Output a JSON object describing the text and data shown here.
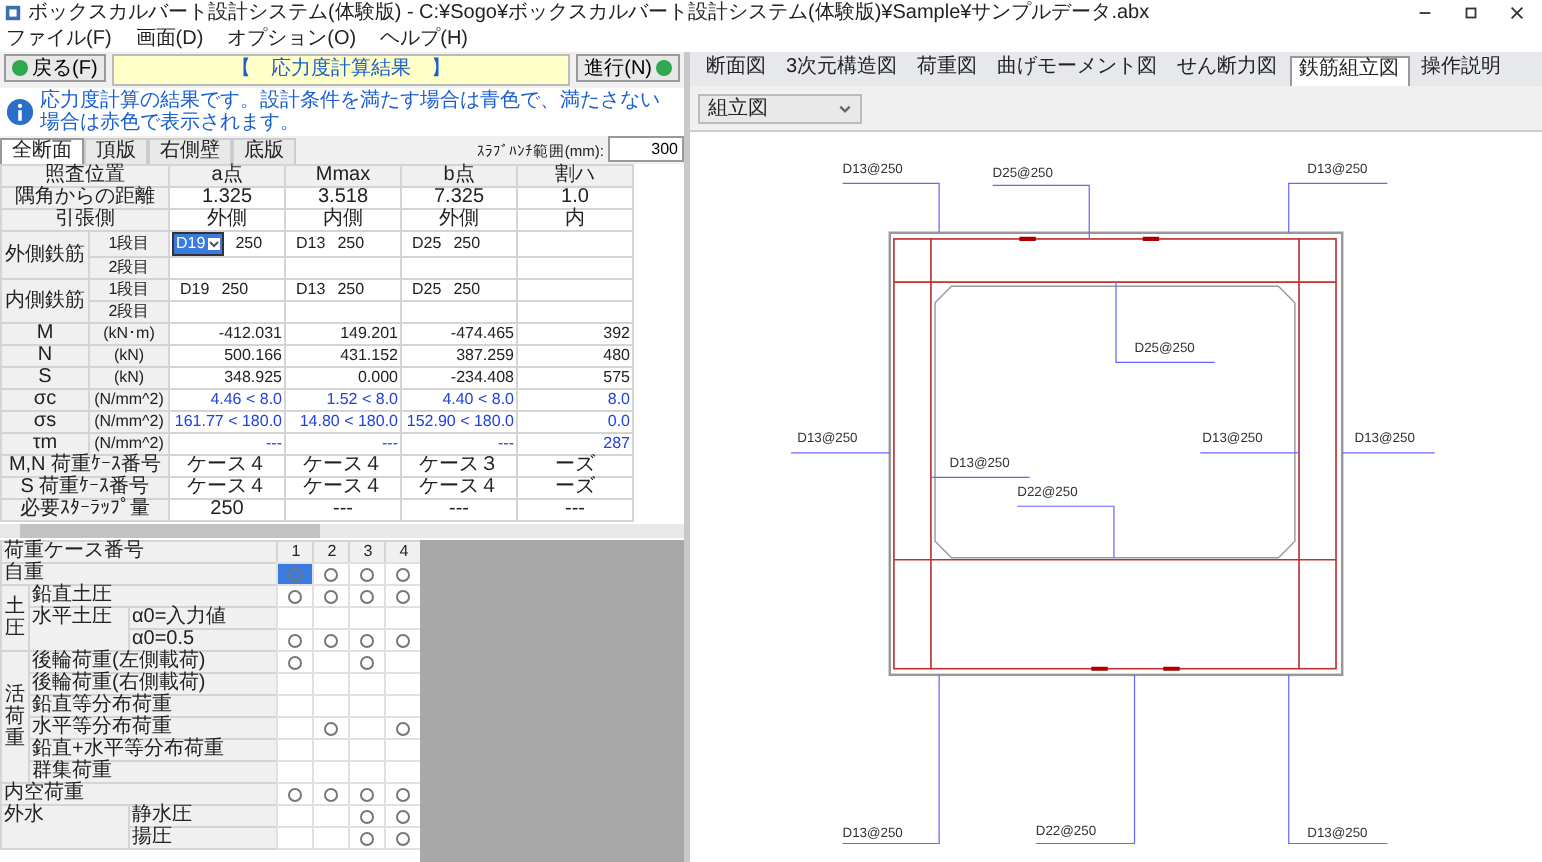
{
  "window": {
    "title": "ボックスカルバート設計システム(体験版) - C:¥Sogo¥ボックスカルバート設計システム(体験版)¥Sample¥サンプルデータ.abx"
  },
  "menu": [
    "ファイル(F)",
    "画面(D)",
    "オプション(O)",
    "ヘルプ(H)"
  ],
  "left_panel": {
    "back_button": "戻る(F)",
    "heading": "【　応力度計算結果　】",
    "next_button": "進行(N)",
    "info": "応力度計算の結果です。設計条件を満たす場合は青色で、満たさない場合は赤色で表示されます。",
    "tabs": [
      {
        "label": "全断面",
        "selected": true
      },
      {
        "label": "頂版",
        "selected": false
      },
      {
        "label": "右側壁",
        "selected": false
      },
      {
        "label": "底版",
        "selected": false
      }
    ],
    "haunch_range": {
      "label": "ｽﾗﾌﾞﾊﾝﾁ範囲(mm):",
      "value": "300"
    },
    "result_table": {
      "columns": [
        "照査位置",
        "a点",
        "Mmax",
        "b点",
        "割ハ"
      ],
      "rows": [
        {
          "kind": "span",
          "label": "隅角からの距離",
          "cells": [
            "1.325",
            "3.518",
            "7.325",
            "1.0"
          ]
        },
        {
          "kind": "span",
          "label": "引張側",
          "cells": [
            "外側",
            "内側",
            "外側",
            "内"
          ]
        },
        {
          "kind": "rebar",
          "label": "外側鉄筋",
          "tiers": [
            {
              "label": "1段目",
              "cells": [
                {
                  "bar": "D19",
                  "pitch": "250",
                  "selected": true
                },
                {
                  "bar": "D13",
                  "pitch": "250",
                  "selected": false
                },
                {
                  "bar": "D25",
                  "pitch": "250",
                  "selected": false
                }
              ]
            },
            {
              "label": "2段目"
            }
          ]
        },
        {
          "kind": "rebar",
          "label": "内側鉄筋",
          "tiers": [
            {
              "label": "1段目",
              "cells": [
                {
                  "bar": "D19",
                  "pitch": "250",
                  "selected": false
                },
                {
                  "bar": "D13",
                  "pitch": "250",
                  "selected": false
                },
                {
                  "bar": "D25",
                  "pitch": "250",
                  "selected": false
                }
              ]
            },
            {
              "label": "2段目"
            }
          ]
        },
        {
          "kind": "value",
          "label": "M",
          "unit": "(kN･m)",
          "cells": [
            "-412.031",
            "149.201",
            "-474.465",
            "392"
          ]
        },
        {
          "kind": "value",
          "label": "N",
          "unit": "(kN)",
          "cells": [
            "500.166",
            "431.152",
            "387.259",
            "480"
          ]
        },
        {
          "kind": "value",
          "label": "S",
          "unit": "(kN)",
          "cells": [
            "348.925",
            "0.000",
            "-234.408",
            "575"
          ]
        },
        {
          "kind": "check",
          "label": "σc",
          "unit": "(N/mm^2)",
          "cells": [
            "4.46 < 8.0",
            "1.52 < 8.0",
            "4.40 < 8.0",
            "8.0"
          ]
        },
        {
          "kind": "check",
          "label": "σs",
          "unit": "(N/mm^2)",
          "cells": [
            "161.77 < 180.0",
            "14.80 < 180.0",
            "152.90 < 180.0",
            "0.0"
          ]
        },
        {
          "kind": "check",
          "label": "τm",
          "unit": "(N/mm^2)",
          "cells": [
            "---",
            "---",
            "---",
            "287"
          ]
        },
        {
          "kind": "span",
          "label": "M,N 荷重ｹｰｽ番号",
          "cells": [
            "ケース４",
            "ケース４",
            "ケース３",
            "ーズ"
          ]
        },
        {
          "kind": "span",
          "label": "S 荷重ｹｰｽ番号",
          "cells": [
            "ケース４",
            "ケース４",
            "ケース４",
            "ーズ"
          ]
        },
        {
          "kind": "span",
          "label": "必要ｽﾀｰﾗｯﾌﾟ量",
          "cells": [
            "250",
            "---",
            "---",
            "---"
          ]
        }
      ]
    },
    "load_case_table": {
      "header": "荷重ケース番号",
      "cases": [
        "1",
        "2",
        "3",
        "4"
      ],
      "rows": [
        {
          "kind": "single",
          "label": "自重",
          "cells": [
            {
              "checked": true,
              "selected": true
            },
            {
              "checked": true,
              "selected": false
            },
            {
              "checked": true,
              "selected": false
            },
            {
              "checked": true,
              "selected": false
            }
          ]
        },
        {
          "kind": "vertical",
          "label": "土圧",
          "items": [
            {
              "label": "鉛直土圧",
              "cells": [
                {
                  "checked": true,
                  "selected": false
                },
                {
                  "checked": true,
                  "selected": false
                },
                {
                  "checked": true,
                  "selected": false
                },
                {
                  "checked": true,
                  "selected": false
                }
              ]
            },
            {
              "label": "水平土圧",
              "subs": [
                {
                  "label": "α0=入力値",
                  "cells": [
                    {
                      "checked": false,
                      "selected": false
                    },
                    {
                      "checked": false,
                      "selected": false
                    },
                    {
                      "checked": false,
                      "selected": false
                    },
                    {
                      "checked": false,
                      "selected": false
                    }
                  ]
                },
                {
                  "label": "α0=0.5",
                  "cells": [
                    {
                      "checked": true,
                      "selected": false
                    },
                    {
                      "checked": true,
                      "selected": false
                    },
                    {
                      "checked": true,
                      "selected": false
                    },
                    {
                      "checked": true,
                      "selected": false
                    }
                  ]
                }
              ]
            }
          ]
        },
        {
          "kind": "vertical",
          "label": "活荷重",
          "items": [
            {
              "label": "後輪荷重(左側載荷)",
              "cells": [
                {
                  "checked": true,
                  "selected": false
                },
                {
                  "checked": false,
                  "selected": false
                },
                {
                  "checked": true,
                  "selected": false
                },
                {
                  "checked": false,
                  "selected": false
                }
              ]
            },
            {
              "label": "後輪荷重(右側載荷)",
              "cells": [
                {
                  "checked": false,
                  "selected": false
                },
                {
                  "checked": false,
                  "selected": false
                },
                {
                  "checked": false,
                  "selected": false
                },
                {
                  "checked": false,
                  "selected": false
                }
              ]
            },
            {
              "label": "鉛直等分布荷重",
              "cells": [
                {
                  "checked": false,
                  "selected": false
                },
                {
                  "checked": false,
                  "selected": false
                },
                {
                  "checked": false,
                  "selected": false
                },
                {
                  "checked": false,
                  "selected": false
                }
              ]
            },
            {
              "label": "水平等分布荷重",
              "cells": [
                {
                  "checked": false,
                  "selected": false
                },
                {
                  "checked": true,
                  "selected": false
                },
                {
                  "checked": false,
                  "selected": false
                },
                {
                  "checked": true,
                  "selected": false
                }
              ]
            },
            {
              "label": "鉛直+水平等分布荷重",
              "cells": [
                {
                  "checked": false,
                  "selected": false
                },
                {
                  "checked": false,
                  "selected": false
                },
                {
                  "checked": false,
                  "selected": false
                },
                {
                  "checked": false,
                  "selected": false
                }
              ]
            },
            {
              "label": "群集荷重",
              "cells": [
                {
                  "checked": false,
                  "selected": false
                },
                {
                  "checked": false,
                  "selected": false
                },
                {
                  "checked": false,
                  "selected": false
                },
                {
                  "checked": false,
                  "selected": false
                }
              ]
            }
          ]
        },
        {
          "kind": "single",
          "label": "内空荷重",
          "cells": [
            {
              "checked": true,
              "selected": false
            },
            {
              "checked": true,
              "selected": false
            },
            {
              "checked": true,
              "selected": false
            },
            {
              "checked": true,
              "selected": false
            }
          ]
        },
        {
          "kind": "wide",
          "label": "外水",
          "items": [
            {
              "label": "静水圧",
              "cells": [
                {
                  "checked": false,
                  "selected": false
                },
                {
                  "checked": false,
                  "selected": false
                },
                {
                  "checked": true,
                  "selected": false
                },
                {
                  "checked": true,
                  "selected": false
                }
              ]
            },
            {
              "label": "揚圧",
              "cells": [
                {
                  "checked": false,
                  "selected": false
                },
                {
                  "checked": false,
                  "selected": false
                },
                {
                  "checked": true,
                  "selected": false
                },
                {
                  "checked": true,
                  "selected": false
                }
              ]
            }
          ]
        }
      ]
    }
  },
  "right_panel": {
    "tabs": [
      {
        "label": "断面図",
        "selected": false
      },
      {
        "label": "3次元構造図",
        "selected": false
      },
      {
        "label": "荷重図",
        "selected": false
      },
      {
        "label": "曲げモーメント図",
        "selected": false
      },
      {
        "label": "せん断力図",
        "selected": false
      },
      {
        "label": "鉄筋組立図",
        "selected": true
      },
      {
        "label": "操作説明",
        "selected": false
      }
    ],
    "view_select": "組立図",
    "drawing": {
      "labels": [
        "D13@250",
        "D25@250",
        "D13@250",
        "D25@250",
        "D13@250",
        "D13@250",
        "D13@250",
        "D13@250",
        "D22@250",
        "D13@250",
        "D22@250",
        "D13@250"
      ]
    }
  }
}
